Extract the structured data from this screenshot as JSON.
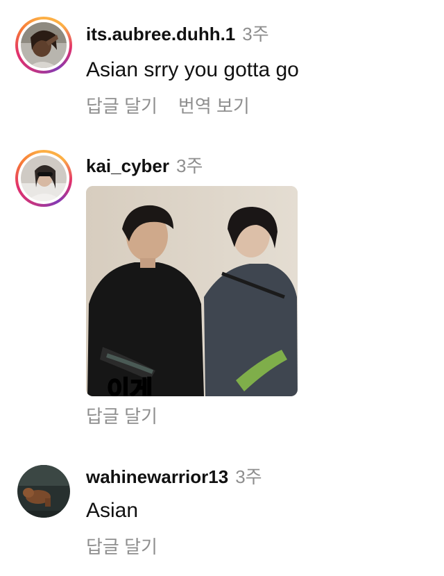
{
  "comments": [
    {
      "username": "its.aubree.duhh.1",
      "time": "3주",
      "text": "Asian srry you gotta go",
      "actions": [
        "답글 달기",
        "번역 보기"
      ]
    },
    {
      "username": "kai_cyber",
      "time": "3주",
      "media": {
        "caption_partial": "이게"
      },
      "actions": [
        "답글 달기"
      ]
    },
    {
      "username": "wahinewarrior13",
      "time": "3주",
      "text": "Asian",
      "actions": [
        "답글 달기"
      ]
    }
  ],
  "colors": {
    "text_primary": "#111111",
    "text_secondary": "#8e8e8e",
    "story_ring_start": "#c13584",
    "story_ring_end": "#fcaf45"
  }
}
